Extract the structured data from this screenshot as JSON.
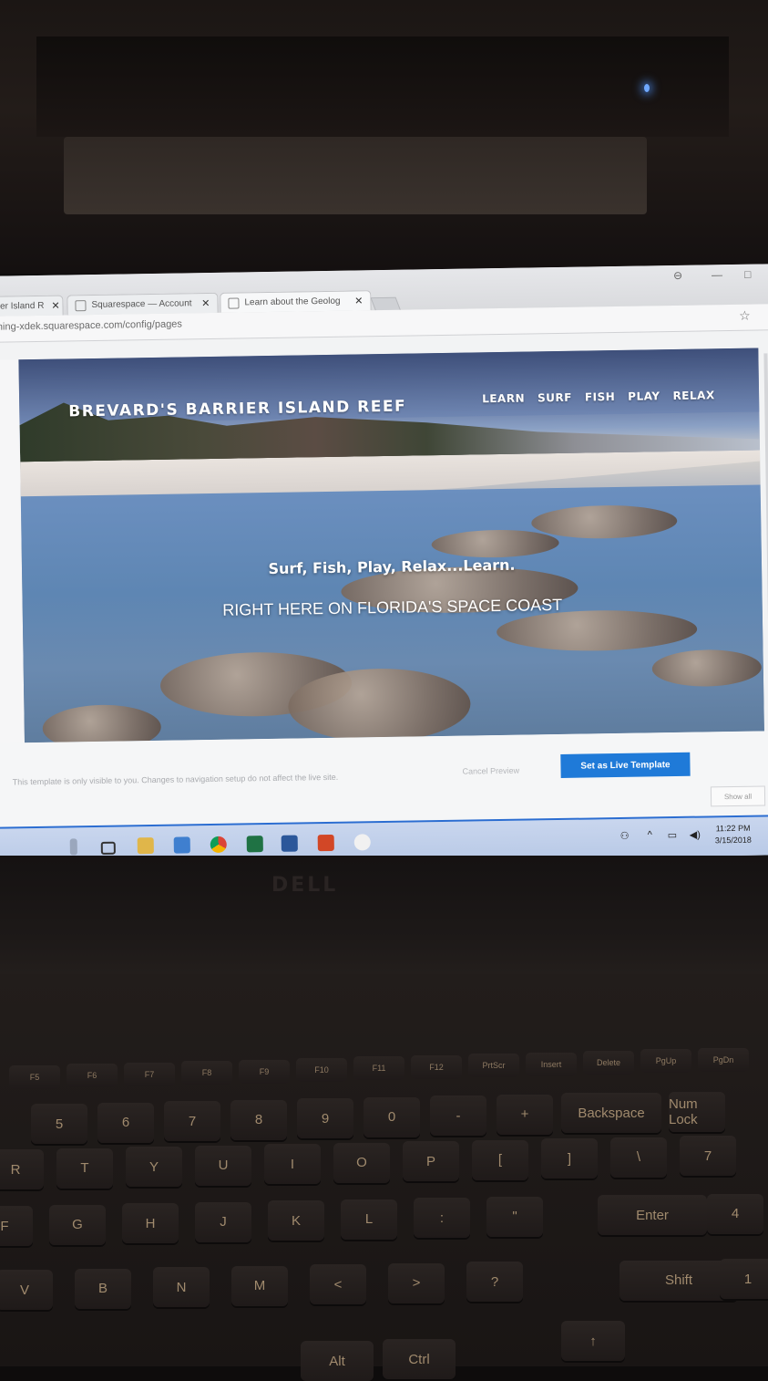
{
  "browser": {
    "tabs": [
      {
        "label": "rier Island R",
        "close": "✕"
      },
      {
        "label": "Squarespace — Account",
        "close": "✕"
      },
      {
        "label": "Learn about the Geolog",
        "close": "✕"
      }
    ],
    "window_controls": {
      "profile": "⊖",
      "minimize": "—",
      "maximize": "□"
    },
    "url": "ming-xdek.squarespace.com/config/pages",
    "bookmark_icon": "☆"
  },
  "site": {
    "logo": "BREVARD'S BARRIER ISLAND REEF",
    "nav": [
      "LEARN",
      "SURF",
      "FISH",
      "PLAY",
      "RELAX"
    ],
    "tagline": "Surf, Fish, Play, Relax...Learn.",
    "subline": "RIGHT HERE ON FLORIDA'S SPACE COAST"
  },
  "editor": {
    "notice": "This template is only visible to you. Changes to navigation setup do not affect the live site.",
    "cancel_label": "Cancel Preview",
    "live_button": "Set as Live Template",
    "show_all": "Show all"
  },
  "taskbar": {
    "time": "11:22 PM",
    "date": "3/15/2018",
    "app_icons": [
      "task-view-icon",
      "file-explorer-icon",
      "store-icon",
      "chrome-icon",
      "excel-icon",
      "word-icon",
      "powerpoint-icon",
      "paint-icon"
    ],
    "accent": "#2b6dd1"
  },
  "laptop": {
    "brand": "DELL",
    "fkeys": [
      "F5",
      "F6",
      "F7",
      "F8",
      "F9",
      "F10",
      "F11",
      "F12",
      "PrtScr",
      "Insert",
      "Delete",
      "PgUp",
      "PgDn"
    ],
    "num_row": [
      "5",
      "6",
      "7",
      "8",
      "9",
      "0",
      "-",
      "+",
      "Backspace",
      "Num Lock"
    ],
    "row_r": [
      "R",
      "T",
      "Y",
      "U",
      "I",
      "O",
      "P",
      "[",
      "]",
      "\\",
      "7"
    ],
    "row_g": [
      "F",
      "G",
      "H",
      "J",
      "K",
      "L",
      ":",
      "\"",
      "Enter",
      "4"
    ],
    "row_b": [
      "V",
      "B",
      "N",
      "M",
      "<",
      ">",
      "?",
      "Shift",
      "1"
    ],
    "bottom": [
      "Alt",
      "Ctrl"
    ]
  }
}
